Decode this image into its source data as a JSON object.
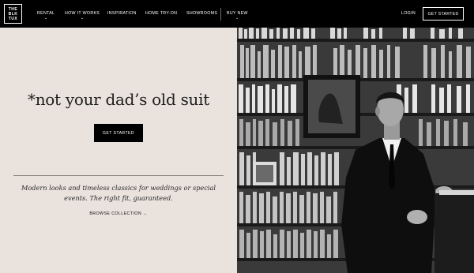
{
  "brand": {
    "logo_lines": [
      "THE",
      "BLK",
      "TUX"
    ]
  },
  "nav": {
    "items": [
      {
        "label": "RENTAL",
        "has_dropdown": true
      },
      {
        "label": "HOW IT WORKS",
        "has_dropdown": true
      },
      {
        "label": "INSPIRATION",
        "has_dropdown": false
      },
      {
        "label": "HOME TRY-ON",
        "has_dropdown": false
      },
      {
        "label": "SHOWROOMS",
        "has_dropdown": false
      },
      {
        "label": "BUY NEW",
        "has_dropdown": true
      }
    ],
    "login_label": "LOGIN",
    "cta_label": "GET STARTED"
  },
  "hero": {
    "headline": "*not your dad’s old suit",
    "cta_label": "GET STARTED",
    "subcopy": "Modern looks and timeless classics for weddings or special events. The right fit, guaranteed.",
    "browse_label": "BROWSE COLLECTION →"
  },
  "icons": {
    "chevron": "chevron-down-icon"
  }
}
